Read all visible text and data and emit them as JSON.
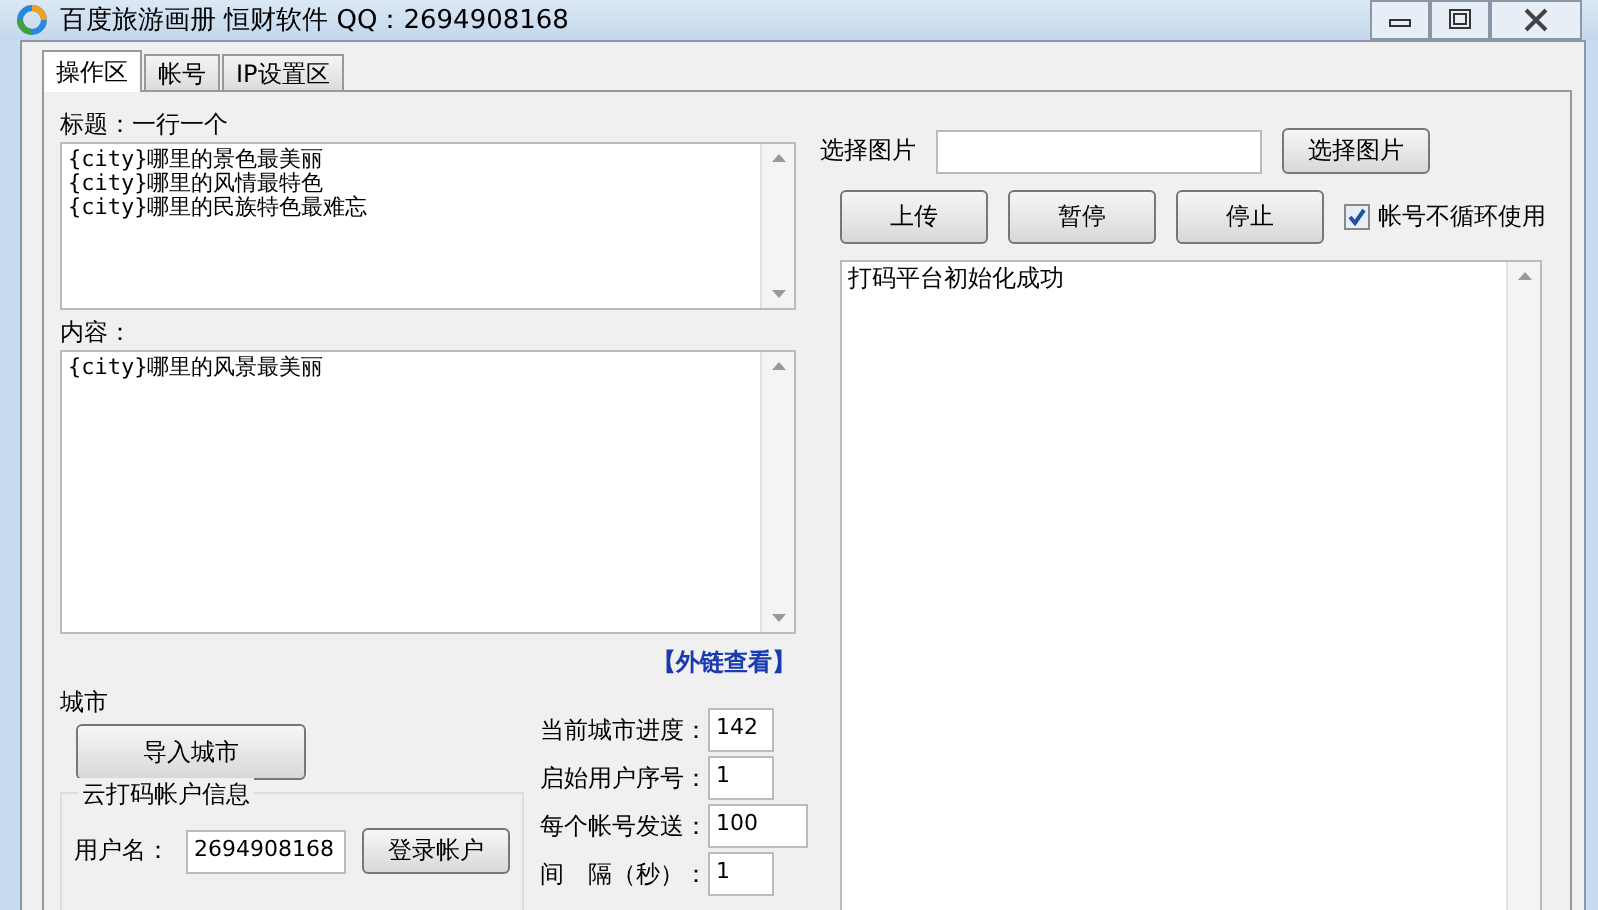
{
  "window": {
    "title": "百度旅游画册  恒财软件 QQ：2694908168"
  },
  "tabs": [
    {
      "label": "操作区",
      "selected": true
    },
    {
      "label": "帐号",
      "selected": false
    },
    {
      "label": "IP设置区",
      "selected": false
    }
  ],
  "title_box": {
    "label": "标题：一行一个",
    "lines": [
      "{city}哪里的景色最美丽",
      "{city}哪里的风情最特色",
      "{city}哪里的民族特色最难忘"
    ]
  },
  "content_box": {
    "label": "内容：",
    "lines": [
      "{city}哪里的风景最美丽"
    ]
  },
  "link": "【外链查看】",
  "city": {
    "label": "城市",
    "button": "导入城市"
  },
  "account_group": {
    "title": "云打码帐户信息",
    "username_label": "用户名：",
    "username": "2694908168",
    "login_button": "登录帐户"
  },
  "stats": [
    {
      "label": "当前城市进度：",
      "value": "142"
    },
    {
      "label": "启始用户序号：",
      "value": "1"
    },
    {
      "label": "每个帐号发送：",
      "value": "100"
    },
    {
      "label": "间　隔（秒）：",
      "value": "1"
    }
  ],
  "image_picker": {
    "label": "选择图片",
    "button": "选择图片"
  },
  "actions": [
    "上传",
    "暂停",
    "停止"
  ],
  "no_cycle": {
    "label": "帐号不循环使用",
    "checked": true
  },
  "log": [
    "打码平台初始化成功"
  ]
}
